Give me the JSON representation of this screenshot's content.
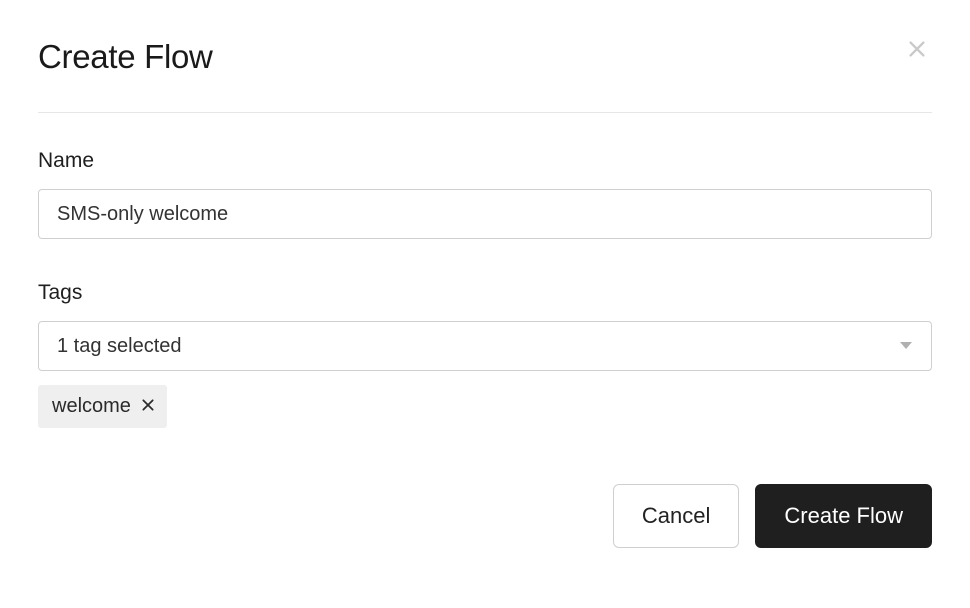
{
  "modal": {
    "title": "Create Flow"
  },
  "form": {
    "name": {
      "label": "Name",
      "value": "SMS-only welcome"
    },
    "tags": {
      "label": "Tags",
      "summary": "1 tag selected",
      "selected": [
        {
          "label": "welcome"
        }
      ]
    }
  },
  "actions": {
    "cancel": "Cancel",
    "submit": "Create Flow"
  }
}
